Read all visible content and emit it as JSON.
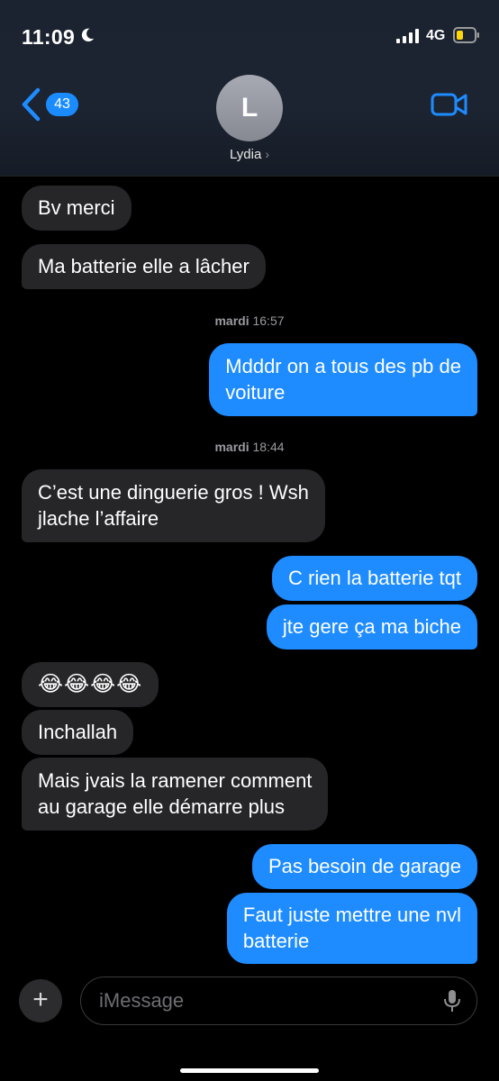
{
  "status_bar": {
    "time": "11:09",
    "network": "4G"
  },
  "header": {
    "back_count": "43",
    "avatar_initial": "L",
    "contact_name": "Lydia",
    "chevron": "›"
  },
  "messages": [
    {
      "dir": "in",
      "text": "Bv merci"
    },
    {
      "dir": "in",
      "text": "Ma batterie elle a lâcher"
    },
    {
      "dir": "out",
      "lines": [
        "Mdddr on a tous des pb de",
        "voiture"
      ]
    },
    {
      "dir": "in",
      "lines": [
        "C’est une dinguerie gros ! Wsh",
        "jlache l’affaire"
      ]
    },
    {
      "dir": "out",
      "text": "C rien la batterie tqt"
    },
    {
      "dir": "out",
      "text": "jte gere ça ma biche"
    },
    {
      "dir": "in",
      "text": "😂😂😂😂"
    },
    {
      "dir": "in",
      "text": "Inchallah"
    },
    {
      "dir": "in",
      "lines": [
        "Mais jvais la ramener comment",
        "au garage elle démarre plus"
      ]
    },
    {
      "dir": "out",
      "text": "Pas besoin de garage"
    },
    {
      "dir": "out",
      "lines": [
        "Faut juste mettre une nvl",
        "batterie"
      ]
    }
  ],
  "timestamps": [
    {
      "day": "mardi",
      "time": "16:57"
    },
    {
      "day": "mardi",
      "time": "18:44"
    }
  ],
  "compose": {
    "placeholder": "iMessage",
    "plus": "+"
  },
  "icons": {
    "back": "chevron-left-icon",
    "video": "video-camera-icon",
    "mic": "microphone-icon",
    "moon": "moon-icon",
    "signal": "cellular-signal-icon",
    "battery": "battery-low-icon"
  },
  "colors": {
    "accent": "#1e8cff",
    "incoming_bubble": "#262629",
    "battery_low": "#ffd60a"
  }
}
